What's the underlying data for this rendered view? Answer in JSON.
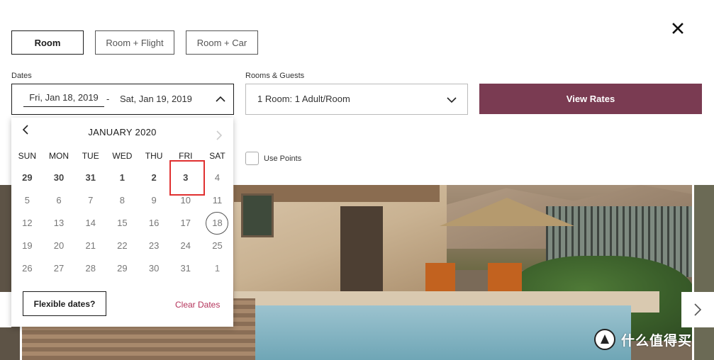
{
  "booking_types": [
    {
      "label": "Room",
      "active": true
    },
    {
      "label": "Room + Flight",
      "active": false
    },
    {
      "label": "Room + Car",
      "active": false
    }
  ],
  "dates": {
    "label": "Dates",
    "check_in": "Fri, Jan 18, 2019",
    "separator": "-",
    "check_out": "Sat, Jan 19, 2019"
  },
  "rooms": {
    "label": "Rooms & Guests",
    "value": "1 Room: 1 Adult/Room"
  },
  "view_rates_label": "View Rates",
  "use_points_label": "Use Points",
  "calendar": {
    "month_title": "JANUARY 2020",
    "days_of_week": [
      "SUN",
      "MON",
      "TUE",
      "WED",
      "THU",
      "FRI",
      "SAT"
    ],
    "weeks": [
      [
        "29",
        "30",
        "31",
        "1",
        "2",
        "3",
        "4"
      ],
      [
        "5",
        "6",
        "7",
        "8",
        "9",
        "10",
        "11"
      ],
      [
        "12",
        "13",
        "14",
        "15",
        "16",
        "17",
        "18"
      ],
      [
        "19",
        "20",
        "21",
        "22",
        "23",
        "24",
        "25"
      ],
      [
        "26",
        "27",
        "28",
        "29",
        "30",
        "31",
        "1"
      ]
    ],
    "flexible_dates_label": "Flexible dates?",
    "clear_dates_label": "Clear Dates"
  },
  "watermark": "什么值得买",
  "colors": {
    "accent": "#7a3b52",
    "clear_link": "#b4325a",
    "highlight_box": "#e03030"
  }
}
